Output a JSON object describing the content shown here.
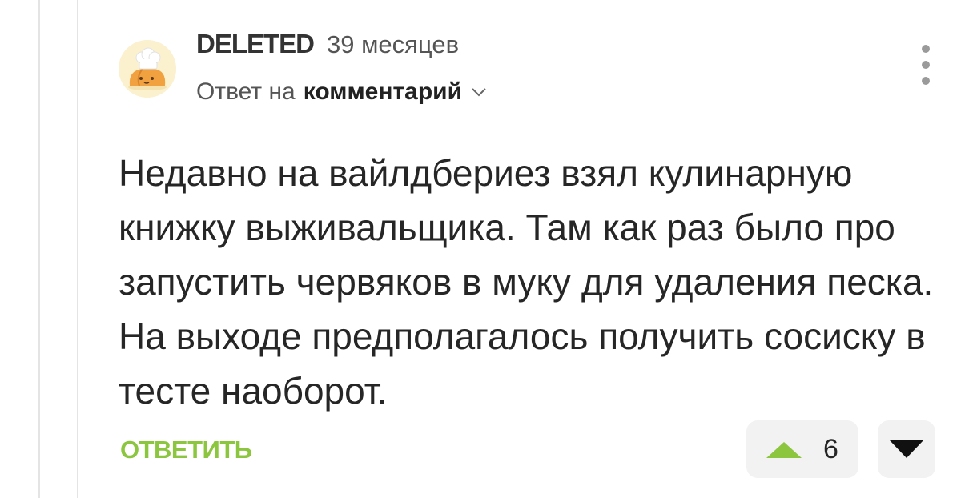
{
  "comment": {
    "author": "DELETED",
    "time": "39 месяцев",
    "reply_prefix": "Ответ на",
    "reply_target": "комментарий",
    "text": "Недавно на вайлдбериез взял кулинарную книжку выживальщика. Там как раз было про запустить червяков в муку для удаления песка. На выходе предполагалось получить сосиску в тесте наоборот.",
    "reply_button": "ОТВЕТИТЬ",
    "rating": "6",
    "icons": {
      "avatar": "chef-hat-bread-avatar",
      "expand": "chevron-down-icon",
      "menu": "more-vertical-icon",
      "upvote": "triangle-up-icon",
      "downvote": "triangle-down-icon"
    },
    "colors": {
      "accent_green": "#8cc63f",
      "text_dark": "#262626",
      "button_bg": "#f2f2f2"
    }
  }
}
